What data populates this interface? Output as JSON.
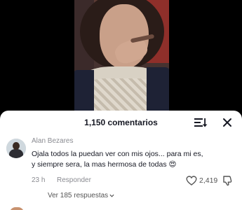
{
  "comments_header": {
    "count_label": "1,150 comentarios"
  },
  "icons": {
    "filter": "filter-sort-icon",
    "close": "close-icon",
    "like": "heart-outline-icon",
    "dislike": "thumbs-down-icon",
    "chevron": "chevron-down-icon"
  },
  "comment": {
    "author": "Alan Bezares",
    "text_line1": "Ojala todos la puedan ver con mis ojos... para mi es,",
    "text_line2": "y siempre sera, la mas hermosa de todas 😍",
    "time": "23 h",
    "reply_label": "Responder",
    "likes": "2,419",
    "view_replies": "Ver 185 respuestas"
  },
  "colors": {
    "sheet_bg": "#ffffff",
    "primary_text": "#161823",
    "secondary_text": "#8a8b91",
    "screen_bg": "#000000"
  }
}
